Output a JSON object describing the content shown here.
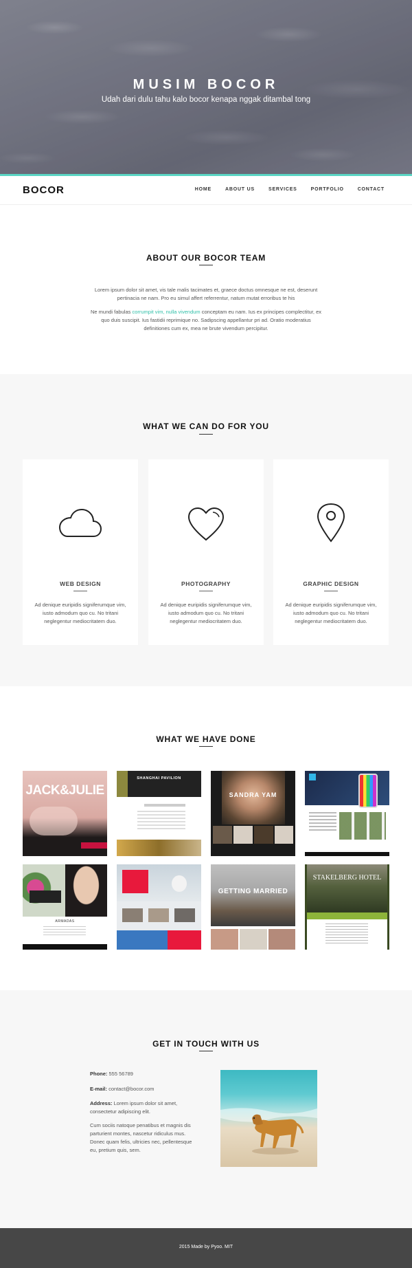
{
  "hero": {
    "title": "MUSIM BOCOR",
    "subtitle": "Udah dari dulu tahu kalo bocor kenapa nggak ditambal tong"
  },
  "nav": {
    "logo": "BOCOR",
    "items": [
      "HOME",
      "ABOUT US",
      "SERVICES",
      "PORTFOLIO",
      "CONTACT"
    ]
  },
  "about": {
    "title": "ABOUT OUR BOCOR TEAM",
    "p1": "Lorem ipsum dolor sit amet, vis tale malis tacimates et, graece doctus omnesque ne est, deserunt pertinacia ne nam. Pro eu simul affert referrentur, natum mutat erroribus te his",
    "p2_before": "Ne mundi fabulas ",
    "p2_link": "corrumpit vim, nulla vivendum",
    "p2_after": " conceptam eu nam. Ius ex principes complectitur, ex quo duis suscipit. Ius fastidii reprimique no. Sadipscing appellantur pri ad. Oratio moderatius definitiones cum ex, mea ne brute vivendum percipitur."
  },
  "services": {
    "title": "WHAT WE CAN DO FOR YOU",
    "items": [
      {
        "icon": "cloud-icon",
        "title": "WEB DESIGN",
        "text": "Ad denique euripidis signiferumque vim, iusto admodum quo cu. No tritani neglegentur mediocritatem duo."
      },
      {
        "icon": "heart-icon",
        "title": "PHOTOGRAPHY",
        "text": "Ad denique euripidis signiferumque vim, iusto admodum quo cu. No tritani neglegentur mediocritatem duo."
      },
      {
        "icon": "location-pin-icon",
        "title": "GRAPHIC DESIGN",
        "text": "Ad denique euripidis signiferumque vim, iusto admodum quo cu. No tritani neglegentur mediocritatem duo."
      }
    ]
  },
  "portfolio": {
    "title": "WHAT WE HAVE DONE",
    "thumbs": {
      "t1": "JACK&JULIE",
      "t2": "SHANGHAI PAVILION",
      "t3": "SANDRA YAM",
      "t5": "ARMADAS",
      "t7": "GETTING MARRIED",
      "t8": "STAKELBERG HOTEL"
    }
  },
  "contact": {
    "title": "GET IN TOUCH WITH US",
    "phone_label": "Phone:",
    "phone": "555 56789",
    "email_label": "E-mail:",
    "email": "contact@bocor.com",
    "address_label": "Address:",
    "address": "Lorem ipsum dolor sit amet, consectetur adipiscing elit.",
    "note": "Cum sociis natoque penatibus et magnis dis parturient montes, nascetur ridiculus mus. Donec quam felis, ultricies nec, pellentesque eu, pretium quis, sem."
  },
  "footer": {
    "text": "2015 Made by Pyoo. MIT"
  },
  "colors": {
    "accent": "#5ad6c4",
    "link": "#2fbfa8",
    "footer_bg": "#474747"
  }
}
